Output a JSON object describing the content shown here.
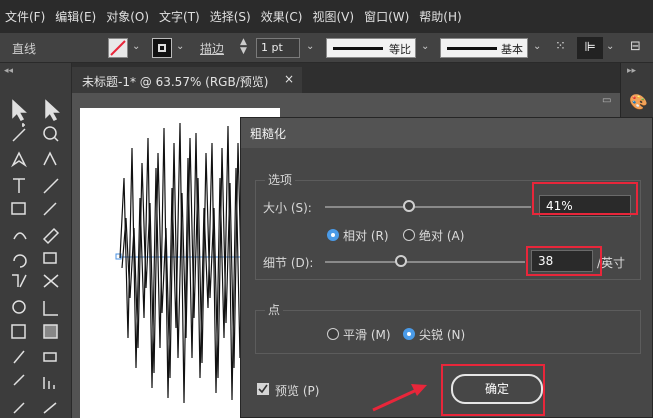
{
  "menu": [
    "文件(F)",
    "编辑(E)",
    "对象(O)",
    "文字(T)",
    "选择(S)",
    "效果(C)",
    "视图(V)",
    "窗口(W)",
    "帮助(H)"
  ],
  "controlbar": {
    "mode_label": "直线",
    "stroke_label": "描边",
    "stroke_weight": "1 pt",
    "profile1_label": "等比",
    "profile2_label": "基本"
  },
  "document_tab": {
    "title": "未标题-1* @ 63.57% (RGB/预览)",
    "close": "×"
  },
  "dialog": {
    "title": "粗糙化",
    "options_label": "选项",
    "size_label": "大小 (S):",
    "size_value": "41%",
    "size_fraction": 0.41,
    "relative_label": "相对 (R)",
    "absolute_label": "绝对 (A)",
    "detail_label": "细节 (D):",
    "detail_value": "38",
    "detail_unit": "/英寸",
    "points_label": "点",
    "smooth_label": "平滑 (M)",
    "corner_label": "尖锐 (N)",
    "preview_label": "预览 (P)",
    "ok_label": "确定"
  },
  "colors": {
    "highlight": "#e8263a",
    "accent": "#4a9be8"
  }
}
